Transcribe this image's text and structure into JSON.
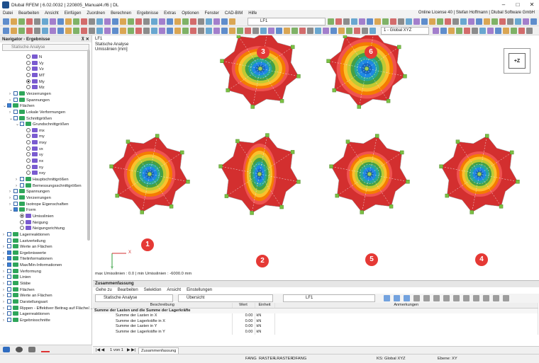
{
  "title": "Dlubal RFEM | 6.02.0032 | 220805_Manual4.rf6 | DL",
  "license": "Online License 40 | Stefan Hoffmann | Dlubal Software GmbH",
  "menu": [
    "Datei",
    "Bearbeiten",
    "Ansicht",
    "Einfügen",
    "Zuordnen",
    "Berechnen",
    "Ergebnisse",
    "Extras",
    "Optionen",
    "Fenster",
    "CAD-BIM",
    "Hilfe"
  ],
  "toolbar": {
    "loadcase_label": "LF1",
    "coord_system": "1 - Global XYZ"
  },
  "navigator": {
    "title": "Navigator - Ergebnisse",
    "analysis": "Statische Analyse",
    "items": [
      {
        "label": "N",
        "level": 3,
        "ctrl": "radio",
        "on": false
      },
      {
        "label": "Vy",
        "level": 3,
        "ctrl": "radio",
        "on": false
      },
      {
        "label": "Vz",
        "level": 3,
        "ctrl": "radio",
        "on": false
      },
      {
        "label": "MT",
        "level": 3,
        "ctrl": "radio",
        "on": false
      },
      {
        "label": "My",
        "level": 3,
        "ctrl": "radio",
        "on": true
      },
      {
        "label": "Mz",
        "level": 3,
        "ctrl": "radio",
        "on": false
      },
      {
        "label": "Verzerrungen",
        "level": 1,
        "ctrl": "check",
        "on": false,
        "exp": ">"
      },
      {
        "label": "Spannungen",
        "level": 1,
        "ctrl": "check",
        "on": false,
        "exp": ">"
      },
      {
        "label": "Flächen",
        "level": 0,
        "ctrl": "check",
        "on": true,
        "exp": "v"
      },
      {
        "label": "Lokale Verformungen",
        "level": 1,
        "ctrl": "check",
        "on": false,
        "exp": ">"
      },
      {
        "label": "Schnittgrößen",
        "level": 1,
        "ctrl": "check",
        "on": false,
        "exp": "v"
      },
      {
        "label": "Grundschnittgrößen",
        "level": 2,
        "ctrl": "check",
        "on": false,
        "exp": "v"
      },
      {
        "label": "mx",
        "level": 3,
        "ctrl": "radio",
        "on": false
      },
      {
        "label": "my",
        "level": 3,
        "ctrl": "radio",
        "on": false
      },
      {
        "label": "mxy",
        "level": 3,
        "ctrl": "radio",
        "on": false
      },
      {
        "label": "vx",
        "level": 3,
        "ctrl": "radio",
        "on": false
      },
      {
        "label": "vy",
        "level": 3,
        "ctrl": "radio",
        "on": false
      },
      {
        "label": "nx",
        "level": 3,
        "ctrl": "radio",
        "on": false
      },
      {
        "label": "ny",
        "level": 3,
        "ctrl": "radio",
        "on": false
      },
      {
        "label": "nxy",
        "level": 3,
        "ctrl": "radio",
        "on": false
      },
      {
        "label": "Hauptschnittgrößen",
        "level": 2,
        "ctrl": "check",
        "on": false,
        "exp": ">"
      },
      {
        "label": "Bemessungsschnittgrößen",
        "level": 2,
        "ctrl": "check",
        "on": false,
        "exp": ">"
      },
      {
        "label": "Spannungen",
        "level": 1,
        "ctrl": "check",
        "on": false,
        "exp": ">"
      },
      {
        "label": "Verzerrungen",
        "level": 1,
        "ctrl": "check",
        "on": false,
        "exp": ">"
      },
      {
        "label": "Isotrope Eigenschaften",
        "level": 1,
        "ctrl": "check",
        "on": false,
        "exp": ">"
      },
      {
        "label": "Form",
        "level": 1,
        "ctrl": "check",
        "on": true,
        "exp": "v"
      },
      {
        "label": "Umisslinien",
        "level": 2,
        "ctrl": "radio",
        "on": true
      },
      {
        "label": "Neigung",
        "level": 2,
        "ctrl": "radio",
        "on": false
      },
      {
        "label": "Neigungsrichtung",
        "level": 2,
        "ctrl": "radio",
        "on": false
      },
      {
        "label": "Lagerreaktionen",
        "level": 0,
        "ctrl": "check",
        "on": false,
        "exp": ">"
      },
      {
        "label": "Lastverteilung",
        "level": 0,
        "ctrl": "check",
        "on": false,
        "exp": ""
      },
      {
        "label": "Werte an Flächen",
        "level": 0,
        "ctrl": "check",
        "on": false,
        "exp": ">"
      },
      {
        "label": "Ergebniswerte",
        "level": 0,
        "ctrl": "check",
        "on": true,
        "exp": ">"
      },
      {
        "label": "Titelinformationen",
        "level": 0,
        "ctrl": "check",
        "on": true,
        "exp": ">"
      },
      {
        "label": "Max/Min-Informationen",
        "level": 0,
        "ctrl": "check",
        "on": true,
        "exp": ">"
      },
      {
        "label": "Verformung",
        "level": 0,
        "ctrl": "check",
        "on": false,
        "exp": ">"
      },
      {
        "label": "Linien",
        "level": 0,
        "ctrl": "check",
        "on": false,
        "exp": ">"
      },
      {
        "label": "Stäbe",
        "level": 0,
        "ctrl": "check",
        "on": false,
        "exp": ">"
      },
      {
        "label": "Flächen",
        "level": 0,
        "ctrl": "check",
        "on": false,
        "exp": ">"
      },
      {
        "label": "Werte an Flächen",
        "level": 0,
        "ctrl": "check",
        "on": false,
        "exp": ">"
      },
      {
        "label": "Darstellungsart",
        "level": 0,
        "ctrl": "check",
        "on": false,
        "exp": ">"
      },
      {
        "label": "Rippen - Effektiver Beitrag auf Fläche/...",
        "level": 0,
        "ctrl": "check",
        "on": false,
        "exp": ">"
      },
      {
        "label": "Lagerreaktionen",
        "level": 0,
        "ctrl": "check",
        "on": false,
        "exp": ">"
      },
      {
        "label": "Ergebnisschnitte",
        "level": 0,
        "ctrl": "check",
        "on": false,
        "exp": ">"
      }
    ]
  },
  "view": {
    "lc": "LF1",
    "analysis": "Statische Analyse",
    "quantity": "Umisslinien [mm]",
    "maxmin": "max Umisslinien : 0.0 | min Umisslinien : -6000.0 mm",
    "cube_label": "+Z",
    "axis_x": "X",
    "axis_y": "Y",
    "markers": [
      "3",
      "6",
      "1",
      "2",
      "5",
      "4"
    ]
  },
  "summary": {
    "title": "Zusammenfassung",
    "menu": [
      "Gehe zu",
      "Bearbeiten",
      "Selektion",
      "Ansicht",
      "Einstellungen"
    ],
    "analysis": "Statische Analyse",
    "overview": "Übersicht",
    "lc": "LF1",
    "headers": [
      "Beschreibung",
      "Wert",
      "Einheit",
      "Anmerkungen"
    ],
    "group": "Summe der Lasten und die Summe der Lagerkräfte",
    "rows": [
      [
        "Summe der Lasten in X",
        "0.00",
        "kN",
        ""
      ],
      [
        "Summe der Lagerkräfte in X",
        "0.00",
        "kN",
        ""
      ],
      [
        "Summe der Lasten in Y",
        "0.00",
        "kN",
        ""
      ],
      [
        "Summe der Lagerkräfte in Y",
        "0.00",
        "kN",
        ""
      ]
    ],
    "pager": "1 von 1",
    "tab": "Zusammenfassung"
  },
  "status": {
    "items": [
      "FANG",
      "RASTER",
      "LRASTER",
      "OFANG"
    ],
    "ks": "KS: Global XYZ",
    "plane": "Ebene: XY"
  },
  "colors": {
    "accent": "#3c7fd4",
    "marker": "#e53935"
  }
}
